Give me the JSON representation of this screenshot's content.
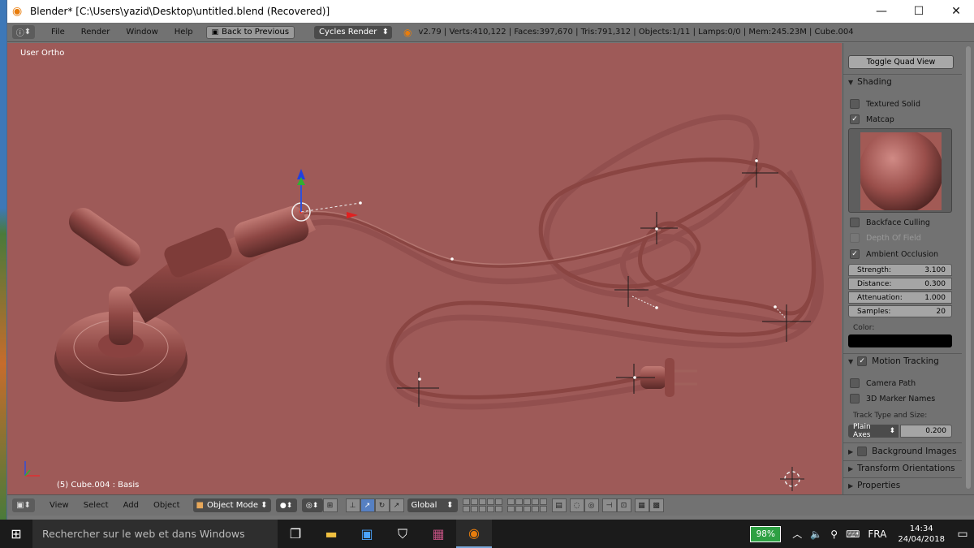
{
  "window": {
    "title": "Blender* [C:\\Users\\yazid\\Desktop\\untitled.blend (Recovered)]",
    "minimize": "—",
    "maximize": "☐",
    "close": "✕"
  },
  "info_header": {
    "editor_icon": "ⓘ",
    "menus": [
      "File",
      "Render",
      "Window",
      "Help"
    ],
    "back_button": "Back to Previous",
    "render_engine": "Cycles Render",
    "stats": "v2.79 | Verts:410,122 | Faces:397,670 | Tris:791,312 | Objects:1/11 | Lamps:0/0 | Mem:245.23M | Cube.004"
  },
  "viewport": {
    "view_label": "User Ortho",
    "object_label": "(5) Cube.004 : Basis",
    "background_color": "#9e5a58"
  },
  "properties_panel": {
    "toggle_quad_view": "Toggle Quad View",
    "shading": {
      "header": "Shading",
      "textured_solid": {
        "label": "Textured Solid",
        "checked": false
      },
      "matcap": {
        "label": "Matcap",
        "checked": true
      },
      "backface_culling": {
        "label": "Backface Culling",
        "checked": false
      },
      "depth_of_field": {
        "label": "Depth Of Field",
        "checked": false,
        "disabled": true
      },
      "ambient_occlusion": {
        "label": "Ambient Occlusion",
        "checked": true
      },
      "ao_fields": [
        {
          "label": "Strength:",
          "value": "3.100"
        },
        {
          "label": "Distance:",
          "value": "0.300"
        },
        {
          "label": "Attenuation:",
          "value": "1.000"
        },
        {
          "label": "Samples:",
          "value": "20"
        }
      ],
      "color_label": "Color:",
      "color_value": "#000000"
    },
    "motion_tracking": {
      "header": "Motion Tracking",
      "enabled": true,
      "camera_path": {
        "label": "Camera Path",
        "checked": false
      },
      "marker_names": {
        "label": "3D Marker Names",
        "checked": false
      },
      "track_label": "Track Type and Size:",
      "track_type": "Plain Axes",
      "track_size": "0.200"
    },
    "background_images": "Background Images",
    "transform_orientations": "Transform Orientations",
    "properties": "Properties"
  },
  "view3d_header": {
    "menus": [
      "View",
      "Select",
      "Add",
      "Object"
    ],
    "mode": "Object Mode",
    "orientation": "Global"
  },
  "taskbar": {
    "search_placeholder": "Rechercher sur le web et dans Windows",
    "battery": "98%",
    "language": "FRA",
    "time": "14:34",
    "date": "24/04/2018"
  }
}
